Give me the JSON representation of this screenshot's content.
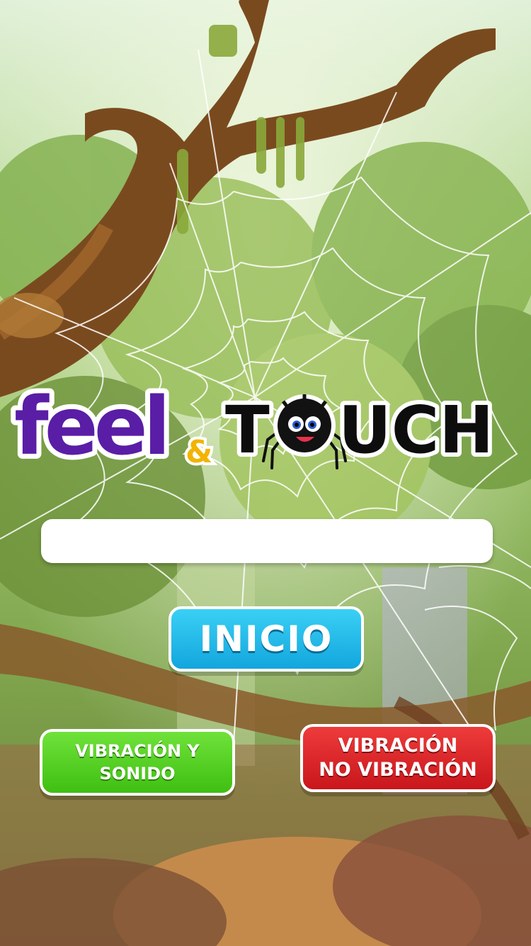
{
  "logo": {
    "word_feel": "feel",
    "ampersand": "&",
    "word_touch_start": "T",
    "word_touch_end": "UCH"
  },
  "name_input": {
    "value": "",
    "placeholder": ""
  },
  "buttons": {
    "start": "INICIO",
    "vibration_sound_line1": "VIBRACIÓN Y",
    "vibration_sound_line2": "SONIDO",
    "vibration_line1": "VIBRACIÓN",
    "vibration_line2": "NO VIBRACIÓN"
  },
  "colors": {
    "feel_purple": "#5a1da6",
    "ampersand_yellow": "#f2b400",
    "start_blue": "#12a6dd",
    "sound_green": "#3fbf12",
    "vibration_red": "#c9161c"
  },
  "icons": [
    "spider-icon",
    "spider-web",
    "tree-branch"
  ]
}
